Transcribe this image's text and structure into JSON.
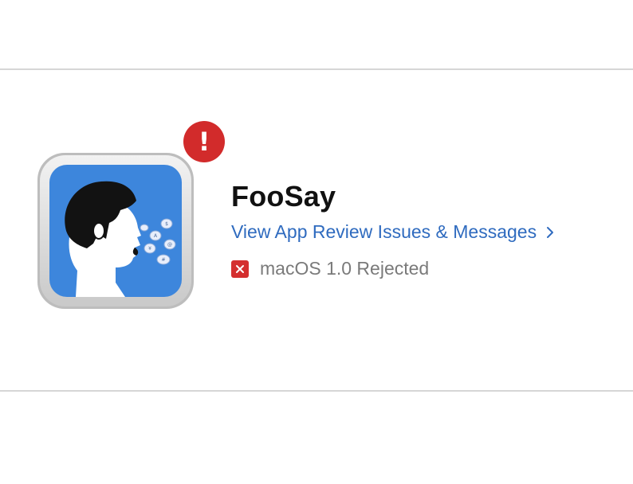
{
  "app": {
    "name": "FooSay",
    "review_link": "View App Review Issues & Messages",
    "status": "macOS 1.0 Rejected",
    "alert_glyph": "!"
  },
  "icons": {
    "app_icon": "speaking-head-icon",
    "alert": "exclamation-icon",
    "chevron": "chevron-right-icon",
    "status": "rejected-x-icon"
  },
  "colors": {
    "link": "#2f6bbf",
    "alert_red": "#d22b2b",
    "status_gray": "#7a7a7a",
    "icon_blue": "#3d86dc"
  }
}
